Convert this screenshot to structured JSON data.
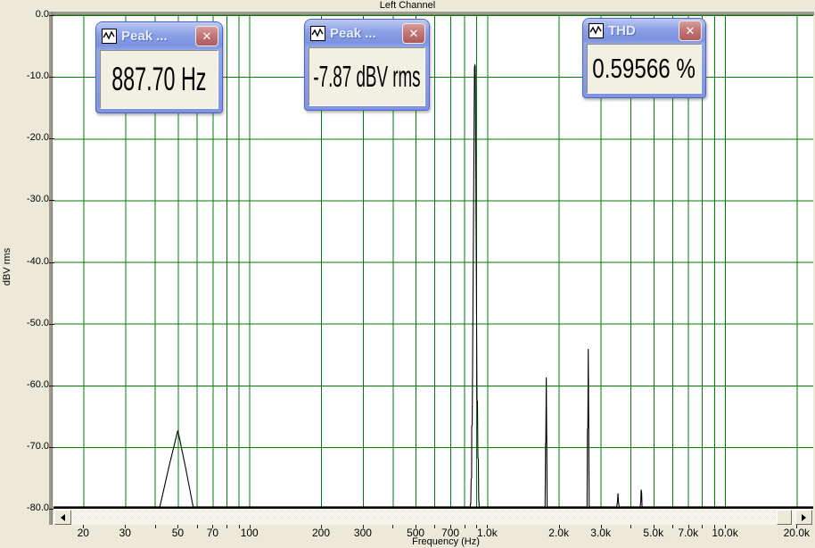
{
  "title": "Left Channel",
  "y_axis": {
    "label": "dBV rms",
    "tick_values": [
      0,
      -10,
      -20,
      -30,
      -40,
      -50,
      -60,
      -70,
      -80
    ],
    "ticks": [
      "0.0",
      "-10.0",
      "-20.0",
      "-30.0",
      "-40.0",
      "-50.0",
      "-60.0",
      "-70.0",
      "-80.0"
    ]
  },
  "x_axis": {
    "label": "Frequency (Hz)",
    "major_ticks": [
      {
        "f": 20,
        "label": "20"
      },
      {
        "f": 30,
        "label": "30"
      },
      {
        "f": 50,
        "label": "50"
      },
      {
        "f": 70,
        "label": "70"
      },
      {
        "f": 100,
        "label": "100"
      },
      {
        "f": 200,
        "label": "200"
      },
      {
        "f": 300,
        "label": "300"
      },
      {
        "f": 500,
        "label": "500"
      },
      {
        "f": 700,
        "label": "700"
      },
      {
        "f": 1000,
        "label": "1.0k"
      },
      {
        "f": 2000,
        "label": "2.0k"
      },
      {
        "f": 3000,
        "label": "3.0k"
      },
      {
        "f": 5000,
        "label": "5.0k"
      },
      {
        "f": 7000,
        "label": "7.0k"
      },
      {
        "f": 10000,
        "label": "10.0k"
      },
      {
        "f": 20000,
        "label": "20.0k"
      }
    ]
  },
  "meters": [
    {
      "title": "Peak ...",
      "value": "887.70 Hz"
    },
    {
      "title": "Peak ...",
      "value": "-7.87 dBV rms"
    },
    {
      "title": "THD",
      "value": "0.59566 %"
    }
  ],
  "icons": {
    "close": "✕",
    "meter_titlebar_icon": "waveform",
    "scroll_left": "left-triangle",
    "scroll_right": "right-triangle"
  },
  "colors": {
    "background": "#ece9d8",
    "plot_background": "#ffffff",
    "grid": "#007e00",
    "trace": "#000000",
    "frame_gray": "#9c9a90",
    "titlebar_blue": "#8ba0e6",
    "close_red": "#c37777",
    "meter_body": "#f2efe3"
  },
  "chart_data": {
    "type": "line",
    "title": "Left Channel",
    "xlabel": "Frequency (Hz)",
    "ylabel": "dBV rms",
    "x_scale": "log",
    "xlim": [
      15.0,
      23500
    ],
    "ylim": [
      -80,
      0
    ],
    "grid": true,
    "grid_color": "#007e00",
    "trace_color": "#000000",
    "legend": "none",
    "gridline_freqs": [
      20,
      30,
      40,
      50,
      60,
      70,
      80,
      90,
      100,
      200,
      300,
      400,
      500,
      600,
      700,
      800,
      900,
      1000,
      2000,
      3000,
      4000,
      5000,
      6000,
      7000,
      8000,
      9000,
      10000,
      20000
    ],
    "notable_peaks": [
      {
        "freq_hz": 50,
        "level_db": -67.3
      },
      {
        "freq_hz": 887.7,
        "level_db": -7.9
      },
      {
        "freq_hz": 1775,
        "level_db": -58.7
      },
      {
        "freq_hz": 2663,
        "level_db": -54.1
      },
      {
        "freq_hz": 3551,
        "level_db": -77.5
      },
      {
        "freq_hz": 4438,
        "level_db": -76.9
      }
    ],
    "series": [
      {
        "name": "spectrum",
        "points": [
          [
            15.1,
            -79.7
          ],
          [
            42,
            -79.7
          ],
          [
            46,
            -73.0
          ],
          [
            50,
            -67.3
          ],
          [
            54,
            -73.5
          ],
          [
            58,
            -79.7
          ],
          [
            848,
            -79.7
          ],
          [
            853,
            -79.0
          ],
          [
            856,
            -75.2
          ],
          [
            860,
            -75.0
          ],
          [
            861,
            -66.6
          ],
          [
            865,
            -66.4
          ],
          [
            884,
            -8.4
          ],
          [
            888,
            -8.1
          ],
          [
            891,
            -8.3
          ],
          [
            906,
            -62.4
          ],
          [
            910,
            -62.6
          ],
          [
            914,
            -71.8
          ],
          [
            918,
            -72.0
          ],
          [
            921,
            -78.4
          ],
          [
            926,
            -79.7
          ],
          [
            1752,
            -79.7
          ],
          [
            1760,
            -69.4
          ],
          [
            1764,
            -69.3
          ],
          [
            1772,
            -58.7
          ],
          [
            1780,
            -69.2
          ],
          [
            1787,
            -79.7
          ],
          [
            2630,
            -79.7
          ],
          [
            2640,
            -67.1
          ],
          [
            2650,
            -66.9
          ],
          [
            2661,
            -54.1
          ],
          [
            2673,
            -67.0
          ],
          [
            2684,
            -79.7
          ],
          [
            3505,
            -79.7
          ],
          [
            3530,
            -78.9
          ],
          [
            3548,
            -77.5
          ],
          [
            3565,
            -78.9
          ],
          [
            3590,
            -79.7
          ],
          [
            4400,
            -79.7
          ],
          [
            4425,
            -78.8
          ],
          [
            4440,
            -76.9
          ],
          [
            4462,
            -77.4
          ],
          [
            4480,
            -79.7
          ],
          [
            23400,
            -79.7
          ]
        ]
      }
    ]
  }
}
